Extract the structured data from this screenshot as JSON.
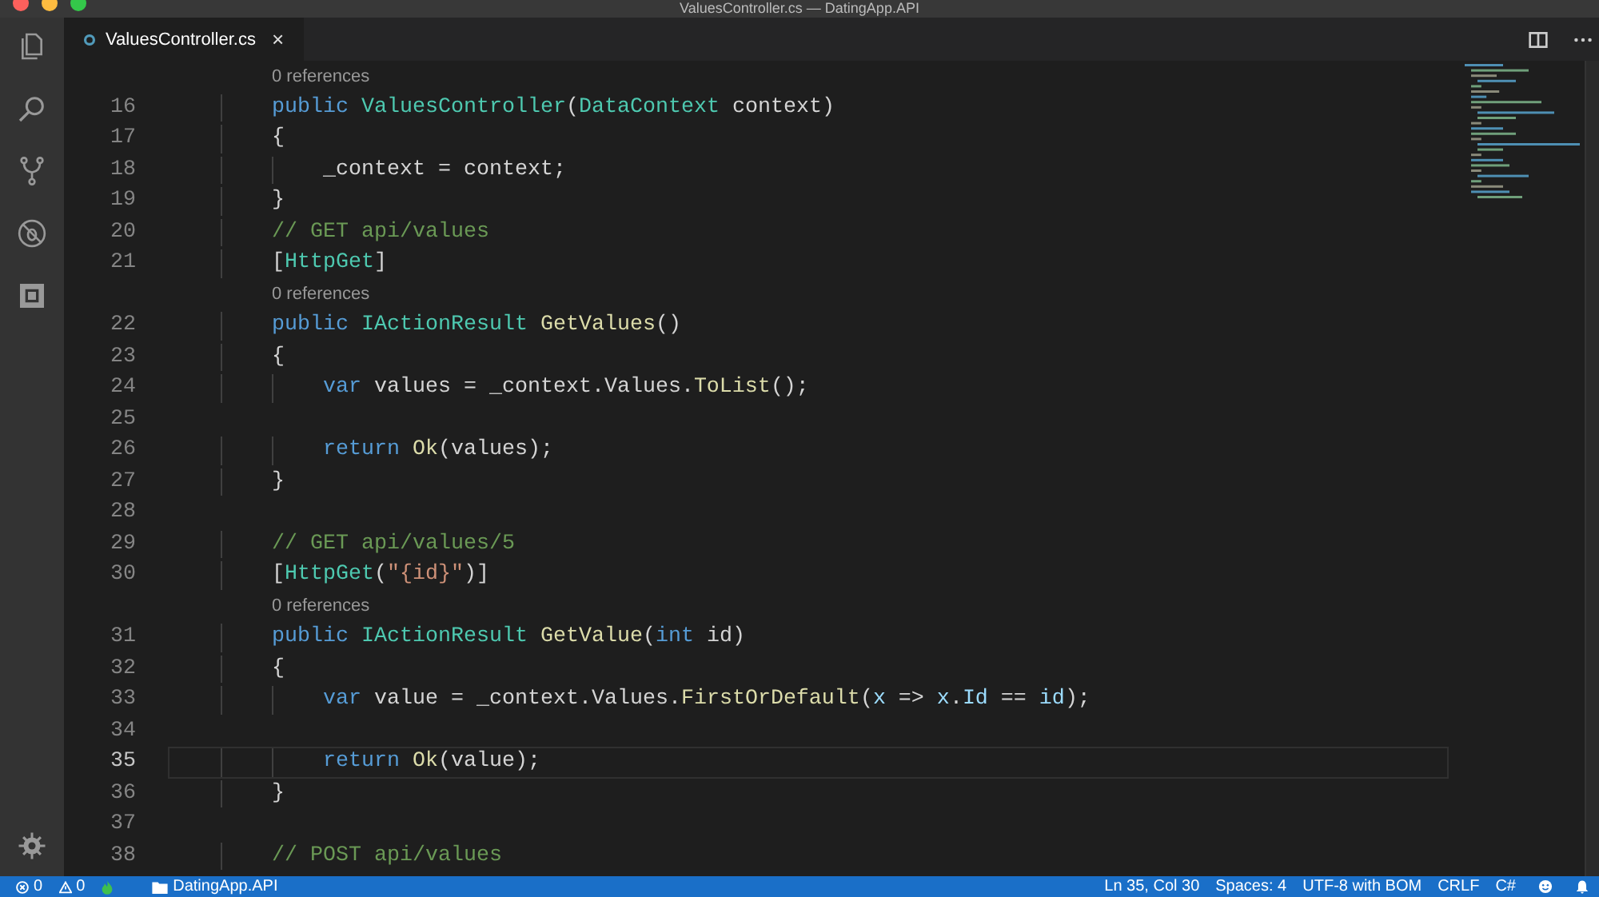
{
  "window": {
    "title": "ValuesController.cs — DatingApp.API"
  },
  "tabs": [
    {
      "label": "ValuesController.cs",
      "selected": true,
      "close": "×"
    }
  ],
  "editor": {
    "rows": [
      {
        "kind": "lens",
        "current": false,
        "text": "0 references"
      },
      {
        "kind": "code",
        "number": "16",
        "current": false,
        "tokens": [
          {
            "kind": "kw",
            "text": "        public"
          },
          {
            "kind": "type",
            "text": " ValuesController"
          },
          {
            "kind": "plain",
            "text": "("
          },
          {
            "kind": "type",
            "text": "DataContext"
          },
          {
            "kind": "plain",
            "text": " context)"
          }
        ]
      },
      {
        "kind": "code",
        "number": "17",
        "current": false,
        "tokens": [
          {
            "kind": "plain",
            "text": "        {"
          }
        ]
      },
      {
        "kind": "code",
        "number": "18",
        "current": false,
        "tokens": [
          {
            "kind": "plain",
            "text": "            _context = context;"
          }
        ]
      },
      {
        "kind": "code",
        "number": "19",
        "current": false,
        "tokens": [
          {
            "kind": "plain",
            "text": "        }"
          }
        ]
      },
      {
        "kind": "code",
        "number": "20",
        "current": false,
        "tokens": [
          {
            "kind": "cmt",
            "text": "        // GET api/values"
          }
        ]
      },
      {
        "kind": "code",
        "number": "21",
        "current": false,
        "tokens": [
          {
            "kind": "plain",
            "text": "        ["
          },
          {
            "kind": "type",
            "text": "HttpGet"
          },
          {
            "kind": "plain",
            "text": "]"
          }
        ]
      },
      {
        "kind": "lens",
        "current": false,
        "text": "0 references"
      },
      {
        "kind": "code",
        "number": "22",
        "current": false,
        "tokens": [
          {
            "kind": "kw",
            "text": "        public"
          },
          {
            "kind": "type",
            "text": " IActionResult"
          },
          {
            "kind": "fn",
            "text": " GetValues"
          },
          {
            "kind": "plain",
            "text": "()"
          }
        ]
      },
      {
        "kind": "code",
        "number": "23",
        "current": false,
        "tokens": [
          {
            "kind": "plain",
            "text": "        {"
          }
        ]
      },
      {
        "kind": "code",
        "number": "24",
        "current": false,
        "tokens": [
          {
            "kind": "kw",
            "text": "            var"
          },
          {
            "kind": "plain",
            "text": " values = _context.Values."
          },
          {
            "kind": "fn",
            "text": "ToList"
          },
          {
            "kind": "plain",
            "text": "();"
          }
        ]
      },
      {
        "kind": "code",
        "number": "25",
        "current": false,
        "tokens": []
      },
      {
        "kind": "code",
        "number": "26",
        "current": false,
        "tokens": [
          {
            "kind": "kw",
            "text": "            return"
          },
          {
            "kind": "fn",
            "text": " Ok"
          },
          {
            "kind": "plain",
            "text": "(values);"
          }
        ]
      },
      {
        "kind": "code",
        "number": "27",
        "current": false,
        "tokens": [
          {
            "kind": "plain",
            "text": "        }"
          }
        ]
      },
      {
        "kind": "code",
        "number": "28",
        "current": false,
        "tokens": []
      },
      {
        "kind": "code",
        "number": "29",
        "current": false,
        "tokens": [
          {
            "kind": "cmt",
            "text": "        // GET api/values/5"
          }
        ]
      },
      {
        "kind": "code",
        "number": "30",
        "current": false,
        "tokens": [
          {
            "kind": "plain",
            "text": "        ["
          },
          {
            "kind": "type",
            "text": "HttpGet"
          },
          {
            "kind": "plain",
            "text": "("
          },
          {
            "kind": "str",
            "text": "\"{id}\""
          },
          {
            "kind": "plain",
            "text": ")]"
          }
        ]
      },
      {
        "kind": "lens",
        "current": false,
        "text": "0 references"
      },
      {
        "kind": "code",
        "number": "31",
        "current": false,
        "tokens": [
          {
            "kind": "kw",
            "text": "        public"
          },
          {
            "kind": "type",
            "text": " IActionResult"
          },
          {
            "kind": "fn",
            "text": " GetValue"
          },
          {
            "kind": "plain",
            "text": "("
          },
          {
            "kind": "kw",
            "text": "int"
          },
          {
            "kind": "plain",
            "text": " id)"
          }
        ]
      },
      {
        "kind": "code",
        "number": "32",
        "current": false,
        "tokens": [
          {
            "kind": "plain",
            "text": "        {"
          }
        ]
      },
      {
        "kind": "code",
        "number": "33",
        "current": false,
        "tokens": [
          {
            "kind": "kw",
            "text": "            var"
          },
          {
            "kind": "plain",
            "text": " value = _context.Values."
          },
          {
            "kind": "fn",
            "text": "FirstOrDefault"
          },
          {
            "kind": "plain",
            "text": "("
          },
          {
            "kind": "var",
            "text": "x"
          },
          {
            "kind": "plain",
            "text": " =>"
          },
          {
            "kind": "var",
            "text": " x"
          },
          {
            "kind": "plain",
            "text": "."
          },
          {
            "kind": "var",
            "text": "Id"
          },
          {
            "kind": "plain",
            "text": " =="
          },
          {
            "kind": "var",
            "text": " id"
          },
          {
            "kind": "plain",
            "text": ");"
          }
        ]
      },
      {
        "kind": "code",
        "number": "34",
        "current": false,
        "tokens": []
      },
      {
        "kind": "code",
        "number": "35",
        "current": true,
        "tokens": [
          {
            "kind": "kw",
            "text": "            return"
          },
          {
            "kind": "fn",
            "text": " Ok"
          },
          {
            "kind": "plain",
            "text": "(value);"
          }
        ]
      },
      {
        "kind": "code",
        "number": "36",
        "current": false,
        "tokens": [
          {
            "kind": "plain",
            "text": "        }"
          }
        ]
      },
      {
        "kind": "code",
        "number": "37",
        "current": false,
        "tokens": []
      },
      {
        "kind": "code",
        "number": "38",
        "current": false,
        "tokens": [
          {
            "kind": "cmt",
            "text": "        // POST api/values"
          }
        ]
      }
    ]
  },
  "status_bar": {
    "left": [
      {
        "kind": "errors",
        "text": "0"
      },
      {
        "kind": "warnings",
        "text": "0"
      },
      {
        "kind": "flame"
      },
      {
        "kind": "folder",
        "text": "DatingApp.API"
      }
    ],
    "right": [
      {
        "kind": "text",
        "text": "Ln 35, Col 30"
      },
      {
        "kind": "text",
        "text": "Spaces: 4"
      },
      {
        "kind": "text",
        "text": "UTF-8 with BOM"
      },
      {
        "kind": "text",
        "text": "CRLF"
      },
      {
        "kind": "text",
        "text": "C#"
      },
      {
        "kind": "smiley"
      },
      {
        "kind": "bell"
      }
    ]
  }
}
